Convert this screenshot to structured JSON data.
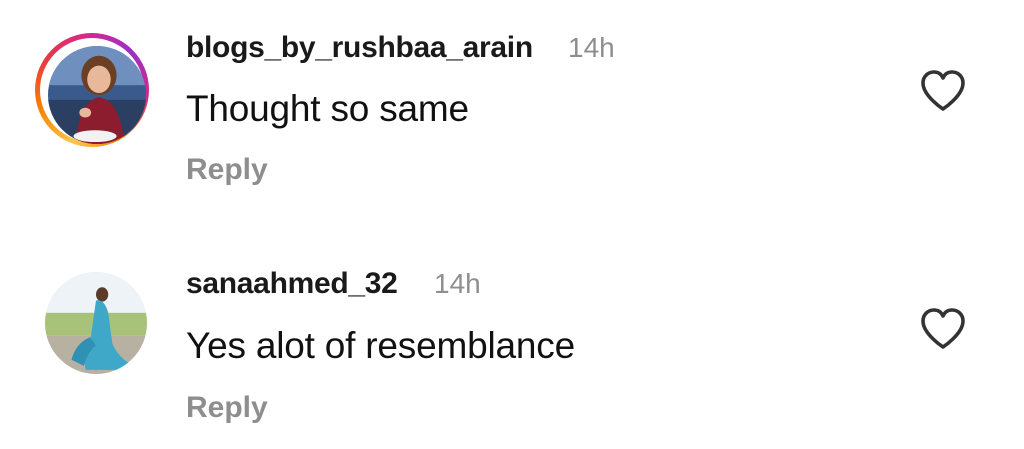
{
  "comments": [
    {
      "username": "blogs_by_rushbaa_arain",
      "time": "14h",
      "text": "Thought so same",
      "reply_label": "Reply",
      "has_story_ring": true,
      "like_icon": "heart-outline-icon"
    },
    {
      "username": "sanaahmed_32",
      "time": "14h",
      "text": "Yes alot of resemblance",
      "reply_label": "Reply",
      "has_story_ring": false,
      "like_icon": "heart-outline-icon"
    }
  ],
  "colors": {
    "text": "#111111",
    "muted": "#8e8e8e",
    "background": "#ffffff",
    "story_ring_start": "#f9c74f",
    "story_ring_end": "#d62889"
  }
}
